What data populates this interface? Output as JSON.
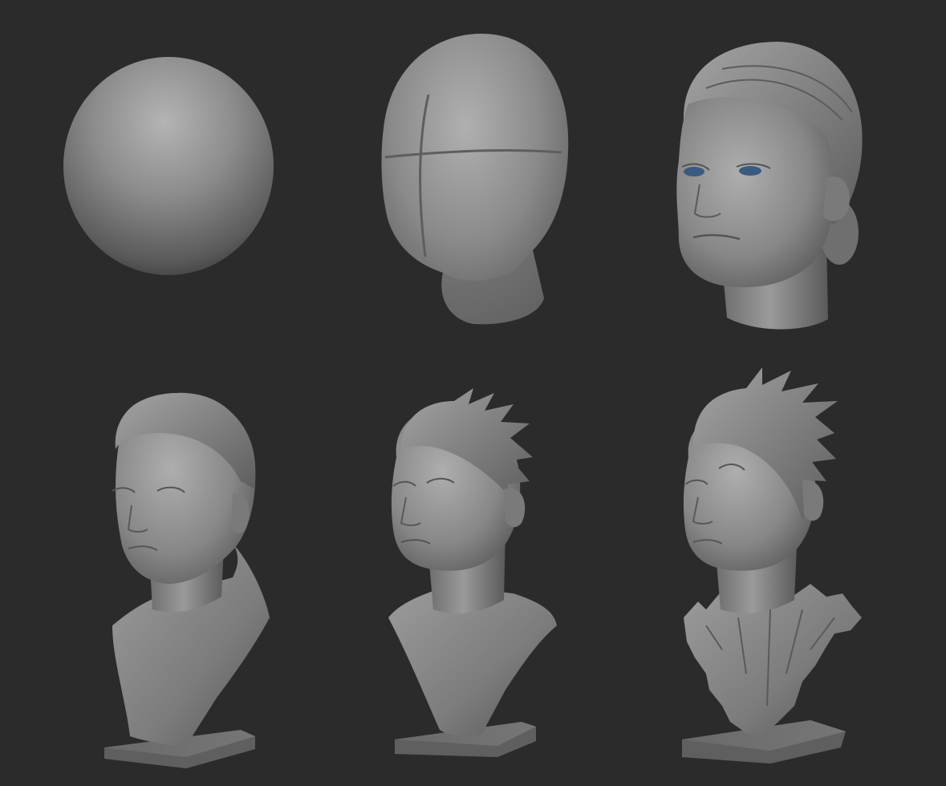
{
  "background_color": "#2b2b2c",
  "model_color": "#8a8a8a",
  "eye_color": "#3b5a80",
  "stages": [
    {
      "name": "sphere"
    },
    {
      "name": "blockout-head"
    },
    {
      "name": "refined-head"
    },
    {
      "name": "bust-slick-hair"
    },
    {
      "name": "bust-windswept-hair"
    },
    {
      "name": "bust-textured-final"
    }
  ]
}
